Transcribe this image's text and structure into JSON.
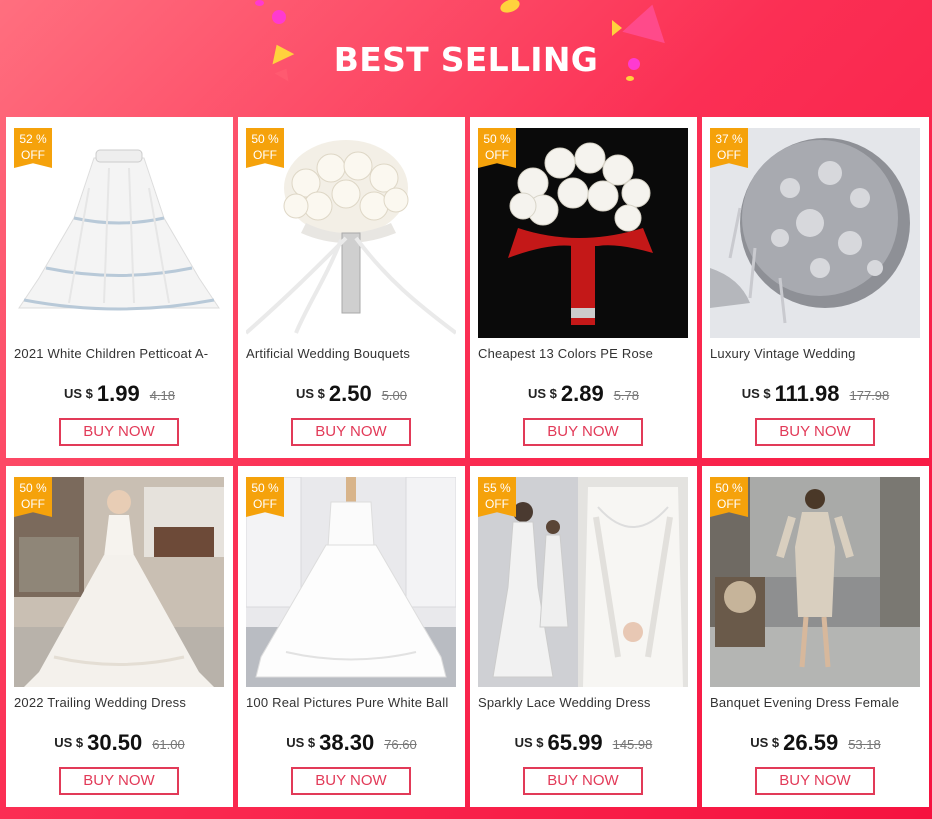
{
  "header": {
    "title": "BEST SELLING"
  },
  "colors": {
    "accent": "#e23a58",
    "badge": "#f5a20b",
    "background": "#fb2f54"
  },
  "products": [
    {
      "badge_pct": "52 %",
      "badge_off": "OFF",
      "title": "2021 White Children Petticoat A-",
      "currency": "US $",
      "price": "1.99",
      "old_price": "4.18",
      "button": "BUY NOW",
      "image": "petticoat"
    },
    {
      "badge_pct": "50 %",
      "badge_off": "OFF",
      "title": "Artificial Wedding Bouquets",
      "currency": "US $",
      "price": "2.50",
      "old_price": "5.00",
      "button": "BUY NOW",
      "image": "white-bouquet"
    },
    {
      "badge_pct": "50 %",
      "badge_off": "OFF",
      "title": "Cheapest 13 Colors PE Rose",
      "currency": "US $",
      "price": "2.89",
      "old_price": "5.78",
      "button": "BUY NOW",
      "image": "red-bouquet"
    },
    {
      "badge_pct": "37 %",
      "badge_off": "OFF",
      "title": "Luxury Vintage Wedding",
      "currency": "US $",
      "price": "111.98",
      "old_price": "177.98",
      "button": "BUY NOW",
      "image": "crystal-bouquet"
    },
    {
      "badge_pct": "50 %",
      "badge_off": "OFF",
      "title": "2022 Trailing Wedding Dress",
      "currency": "US $",
      "price": "30.50",
      "old_price": "61.00",
      "button": "BUY NOW",
      "image": "trailing-dress"
    },
    {
      "badge_pct": "50 %",
      "badge_off": "OFF",
      "title": "100 Real Pictures Pure White Ball",
      "currency": "US $",
      "price": "38.30",
      "old_price": "76.60",
      "button": "BUY NOW",
      "image": "ball-gown"
    },
    {
      "badge_pct": "55 %",
      "badge_off": "OFF",
      "title": "Sparkly Lace Wedding Dress",
      "currency": "US $",
      "price": "65.99",
      "old_price": "145.98",
      "button": "BUY NOW",
      "image": "lace-dress"
    },
    {
      "badge_pct": "50 %",
      "badge_off": "OFF",
      "title": "Banquet Evening Dress Female",
      "currency": "US $",
      "price": "26.59",
      "old_price": "53.18",
      "button": "BUY NOW",
      "image": "evening-dress"
    }
  ]
}
